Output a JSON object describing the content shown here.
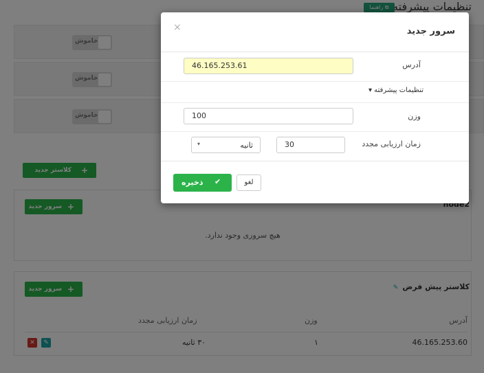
{
  "page": {
    "title": "تنظیمات پیشرفته",
    "help_label": "راهنما"
  },
  "toggles": [
    {
      "label": "خاموش"
    },
    {
      "label": "خاموش"
    },
    {
      "label": "خاموش"
    }
  ],
  "cluster_section": {
    "new_cluster_label": "کلاستر جدید"
  },
  "node2_card": {
    "name": "node2",
    "new_server_label": "سرور جدید",
    "empty_message": "هیچ سروری وجود ندارد."
  },
  "default_cluster": {
    "title": "کلاستر پیش فرض",
    "new_server_label": "سرور جدید",
    "columns": {
      "address": "آدرس",
      "weight": "وزن",
      "recheck": "زمان ارزیابی مجدد"
    },
    "rows": [
      {
        "address": "46.165.253.60",
        "weight": "۱",
        "recheck": "۳۰ ثانیه"
      }
    ]
  },
  "modal": {
    "title": "سرور جدید",
    "close": "×",
    "address_label": "آدرس",
    "address_value": "46.165.253.61",
    "advanced_label": "تنظیمات پیشرفته",
    "weight_label": "وزن",
    "weight_value": "100",
    "recheck_label": "زمان ارزیابی مجدد",
    "recheck_value": "30",
    "unit_selected": "ثانیه",
    "save_label": "ذخیره",
    "cancel_label": "لغو"
  },
  "colors": {
    "accent_green": "#2bb34a",
    "help_teal": "#26a57a",
    "edit_teal": "#1aa3a3",
    "delete_red": "#d0342c",
    "highlight_yellow": "#fdfdc4"
  }
}
